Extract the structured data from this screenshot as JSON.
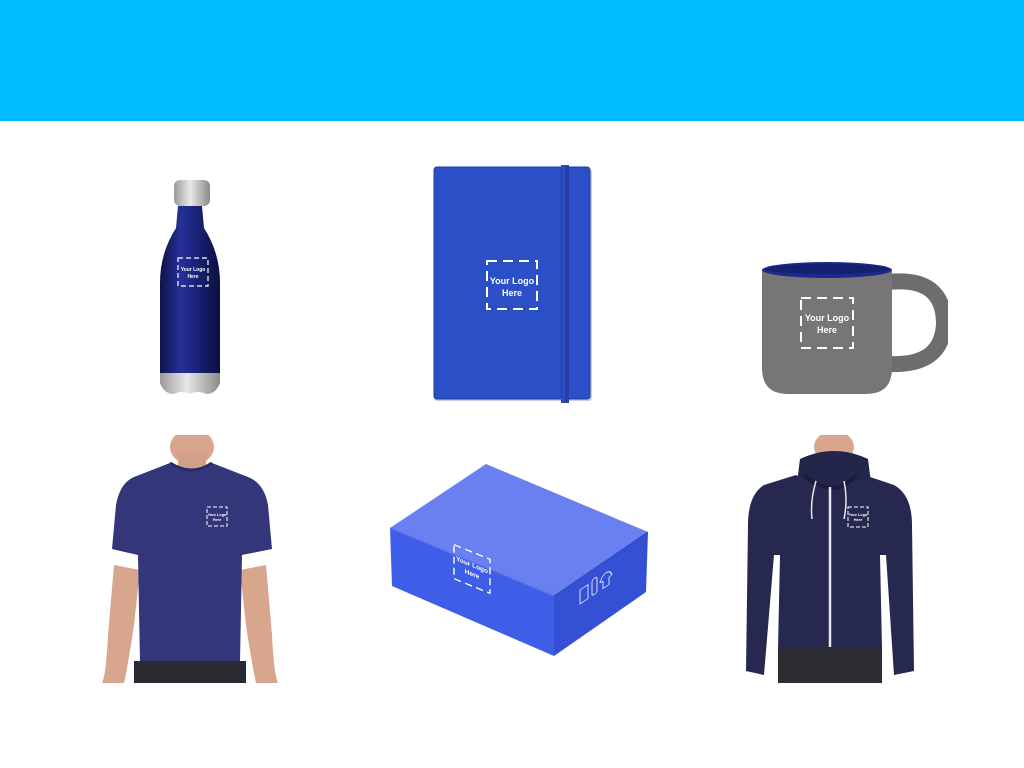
{
  "banner": {
    "color": "#00bbff"
  },
  "logo_placeholder": {
    "line1": "Your Logo",
    "line2": "Here"
  },
  "products": [
    {
      "id": "water-bottle",
      "color": "#1b2472"
    },
    {
      "id": "notebook",
      "color": "#2a4fc6"
    },
    {
      "id": "mug",
      "color": "#767676"
    },
    {
      "id": "t-shirt",
      "color": "#34367a"
    },
    {
      "id": "shipping-box",
      "color": "#3f5ee8"
    },
    {
      "id": "hoodie",
      "color": "#26284f"
    }
  ]
}
